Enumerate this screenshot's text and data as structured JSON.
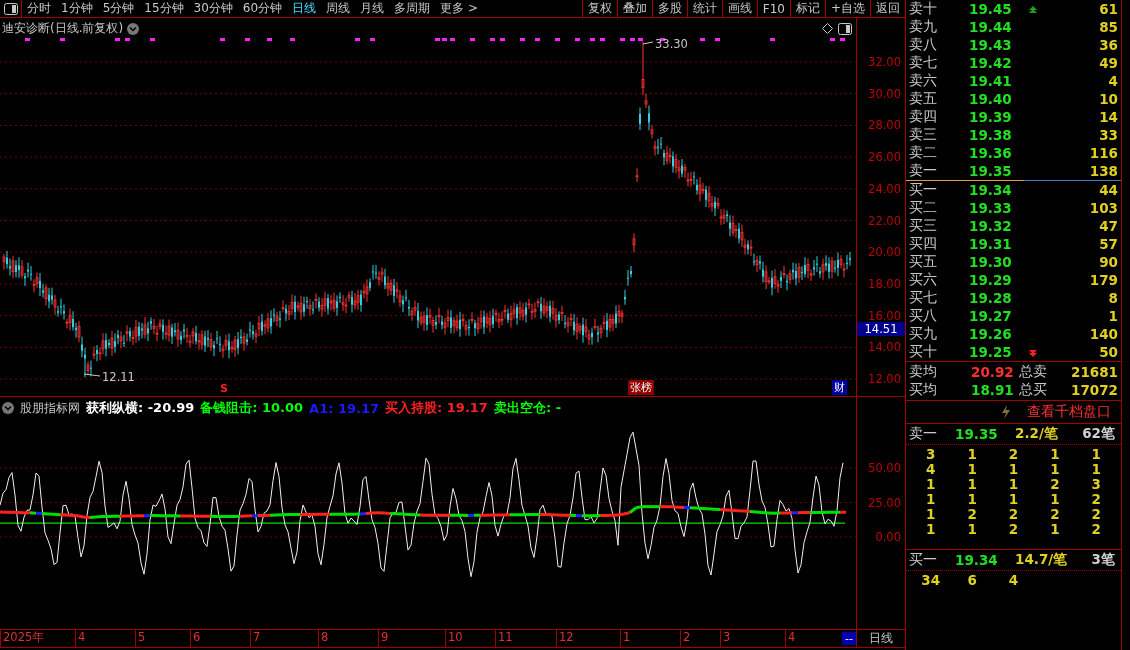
{
  "toolbar": {
    "periods": [
      {
        "label": "分时",
        "selected": false
      },
      {
        "label": "1分钟",
        "selected": false
      },
      {
        "label": "5分钟",
        "selected": false
      },
      {
        "label": "15分钟",
        "selected": false
      },
      {
        "label": "30分钟",
        "selected": false
      },
      {
        "label": "60分钟",
        "selected": false
      },
      {
        "label": "日线",
        "selected": true
      },
      {
        "label": "周线",
        "selected": false
      },
      {
        "label": "月线",
        "selected": false
      },
      {
        "label": "多周期",
        "selected": false
      },
      {
        "label": "更多 >",
        "selected": false
      }
    ],
    "tools": [
      "复权",
      "叠加",
      "多股",
      "统计",
      "画线",
      "F10",
      "标记",
      "+自选",
      "返回"
    ]
  },
  "price_panel": {
    "title": "迪安诊断(日线.前复权)",
    "axis_labels": [
      "32.00",
      "30.00",
      "28.00",
      "26.00",
      "24.00",
      "22.00",
      "20.00",
      "18.00",
      "16.00",
      "14.00",
      "12.00"
    ],
    "high_label": "33.30",
    "low_label": "12.11",
    "current_price": "14.51",
    "signal": "S",
    "event_tags": [
      {
        "label": "张榜",
        "kind": "news"
      },
      {
        "label": "财",
        "kind": "finance"
      }
    ]
  },
  "indicator_panel": {
    "name": "股朋指标网",
    "axis_labels": [
      "50.00",
      "25.00",
      "0.00"
    ],
    "legend": [
      {
        "text": "获利纵横: -20.99",
        "color": "#ffffff"
      },
      {
        "text": "备钱阻击: 10.00",
        "color": "#00ff00"
      },
      {
        "text": "A1: 19.17",
        "color": "#1a1aff"
      },
      {
        "text": "买入持股: 19.17",
        "color": "#ff2020"
      },
      {
        "text": "卖出空仓: -",
        "color": "#00ff00"
      }
    ]
  },
  "date_axis": {
    "labels": [
      "2025年",
      "4",
      "5",
      "6",
      "7",
      "8",
      "9",
      "10",
      "11",
      "12",
      "1",
      "2",
      "3",
      "4"
    ],
    "end_marker": "--",
    "period": "日线"
  },
  "order_book": {
    "asks": [
      {
        "label": "卖十",
        "price": "19.45",
        "volume": "61"
      },
      {
        "label": "卖九",
        "price": "19.44",
        "volume": "85"
      },
      {
        "label": "卖八",
        "price": "19.43",
        "volume": "36"
      },
      {
        "label": "卖七",
        "price": "19.42",
        "volume": "49"
      },
      {
        "label": "卖六",
        "price": "19.41",
        "volume": "4"
      },
      {
        "label": "卖五",
        "price": "19.40",
        "volume": "10"
      },
      {
        "label": "卖四",
        "price": "19.39",
        "volume": "14"
      },
      {
        "label": "卖三",
        "price": "19.38",
        "volume": "33"
      },
      {
        "label": "卖二",
        "price": "19.36",
        "volume": "116"
      },
      {
        "label": "卖一",
        "price": "19.35",
        "volume": "138"
      }
    ],
    "bids": [
      {
        "label": "买一",
        "price": "19.34",
        "volume": "44"
      },
      {
        "label": "买二",
        "price": "19.33",
        "volume": "103"
      },
      {
        "label": "买三",
        "price": "19.32",
        "volume": "47"
      },
      {
        "label": "买四",
        "price": "19.31",
        "volume": "57"
      },
      {
        "label": "买五",
        "price": "19.30",
        "volume": "90"
      },
      {
        "label": "买六",
        "price": "19.29",
        "volume": "179"
      },
      {
        "label": "买七",
        "price": "19.28",
        "volume": "8"
      },
      {
        "label": "买八",
        "price": "19.27",
        "volume": "1"
      },
      {
        "label": "买九",
        "price": "19.26",
        "volume": "140"
      },
      {
        "label": "买十",
        "price": "19.25",
        "volume": "50"
      }
    ],
    "summary": [
      {
        "label": "卖均",
        "price": "20.92",
        "color": "#ff3030",
        "total_label": "总卖",
        "total": "21681"
      },
      {
        "label": "买均",
        "price": "18.91",
        "color": "#20e020",
        "total_label": "总买",
        "total": "17072"
      }
    ],
    "depth_link": "查看千档盘口",
    "ask_queue": {
      "label": "卖一",
      "price": "19.35",
      "avg": "2.2/笔",
      "count": "62笔",
      "orders": [
        [
          "3",
          "1",
          "2",
          "1",
          "1"
        ],
        [
          "4",
          "1",
          "1",
          "1",
          "1"
        ],
        [
          "1",
          "1",
          "1",
          "2",
          "3"
        ],
        [
          "1",
          "1",
          "1",
          "1",
          "2"
        ],
        [
          "1",
          "2",
          "2",
          "2",
          "2"
        ],
        [
          "1",
          "1",
          "2",
          "1",
          "2"
        ]
      ]
    },
    "bid_queue": {
      "label": "买一",
      "price": "19.34",
      "avg": "14.7/笔",
      "count": "3笔",
      "orders": [
        [
          "34",
          "6",
          "4"
        ]
      ]
    }
  }
}
